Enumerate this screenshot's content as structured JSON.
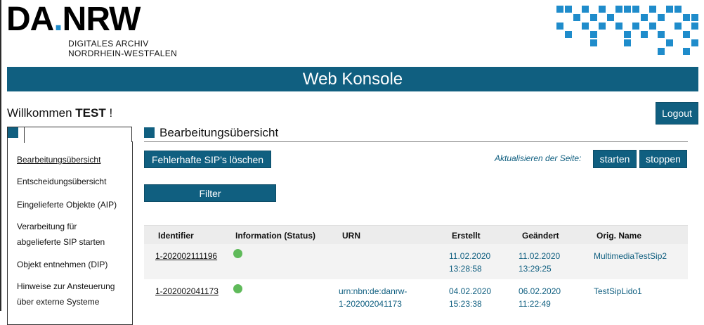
{
  "logo": {
    "title_da": "DA",
    "title_dot": ".",
    "title_nrw": "NRW",
    "sub_line1": "DIGITALES ARCHIV",
    "sub_line2": "NORDRHEIN-WESTFALEN"
  },
  "colors": {
    "primary": "#105f80",
    "accent_blue": "#1f8ccb",
    "status_ok": "#5fba5a"
  },
  "banner": {
    "title": "Web Konsole"
  },
  "welcome": {
    "prefix": "Willkommen",
    "user": "TEST",
    "suffix": "!"
  },
  "logout_label": "Logout",
  "sidebar": {
    "items": [
      {
        "label": "Bearbeitungsübersicht",
        "active": true
      },
      {
        "label": "Entscheidungsübersicht"
      },
      {
        "label": "Eingelieferte Objekte (AIP)"
      },
      {
        "label": "Verarbeitung für",
        "label2": "abgelieferte SIP starten"
      },
      {
        "label": "Objekt entnehmen (DIP)"
      },
      {
        "label": "Hinweise zur Ansteuerung",
        "label2": "über externe Systeme"
      }
    ]
  },
  "main": {
    "title": "Bearbeitungsübersicht",
    "delete_button": "Fehlerhafte SIP's löschen",
    "refresh_label": "Aktualisieren der Seite:",
    "start_button": "starten",
    "stop_button": "stoppen",
    "filter_button": "Filter"
  },
  "table": {
    "headers": [
      "Identifier",
      "Information (Status)",
      "URN",
      "Erstellt",
      "Geändert",
      "Orig. Name"
    ],
    "rows": [
      {
        "identifier": "1-202002111196",
        "status": "green-dot-icon",
        "urn1": "",
        "urn2": "",
        "created_date": "11.02.2020",
        "created_time": "13:28:58",
        "changed_date": "11.02.2020",
        "changed_time": "13:29:25",
        "orig_name": "MultimediaTestSip2"
      },
      {
        "identifier": "1-202002041173",
        "status": "green-dot-icon",
        "urn1": "urn:nbn:de:danrw-",
        "urn2": "1-202002041173",
        "created_date": "04.02.2020",
        "created_time": "15:23:38",
        "changed_date": "06.02.2020",
        "changed_time": "11:22:49",
        "orig_name": "TestSipLido1"
      }
    ]
  }
}
